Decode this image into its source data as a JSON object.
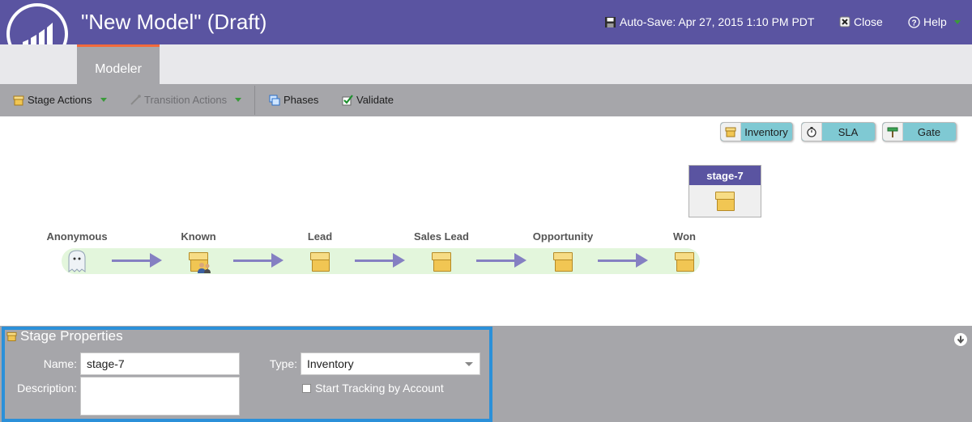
{
  "header": {
    "title": "\"New Model\" (Draft)",
    "autosave": "Auto-Save: Apr 27, 2015 1:10 PM PDT",
    "close_label": "Close",
    "help_label": "Help"
  },
  "tabs": [
    {
      "label": "Modeler",
      "active": true
    }
  ],
  "toolbar": {
    "stage_actions": "Stage Actions",
    "transition_actions": "Transition Actions",
    "phases": "Phases",
    "validate": "Validate"
  },
  "palette": {
    "inventory": "Inventory",
    "sla": "SLA",
    "gate": "Gate"
  },
  "floating_stage": {
    "label": "stage-7"
  },
  "flow": {
    "stages": [
      {
        "label": "Anonymous",
        "icon": "ghost-icon"
      },
      {
        "label": "Known",
        "icon": "box-people-icon"
      },
      {
        "label": "Lead",
        "icon": "box-icon"
      },
      {
        "label": "Sales Lead",
        "icon": "box-icon"
      },
      {
        "label": "Opportunity",
        "icon": "box-icon"
      },
      {
        "label": "Won",
        "icon": "box-icon"
      }
    ]
  },
  "properties": {
    "title": "Stage Properties",
    "name_label": "Name:",
    "name_value": "stage-7",
    "description_label": "Description:",
    "description_value": "",
    "type_label": "Type:",
    "type_value": "Inventory",
    "tracking_label": "Start Tracking by Account",
    "tracking_checked": false
  },
  "colors": {
    "header": "#5a54a1",
    "tab_accent": "#f26a3b",
    "panel": "#a6a6aa",
    "selection": "#2b90d9",
    "flow_bar": "#e3f6dc",
    "arrow": "#8580c2",
    "palette_button": "#7fc9d3"
  }
}
